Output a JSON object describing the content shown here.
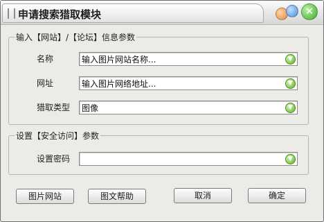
{
  "window": {
    "title": "申请搜索猎取模块"
  },
  "group1": {
    "legend": "输入【网站】/【论坛】信息参数",
    "fields": [
      {
        "label": "名称",
        "value": "输入图片网站名称..."
      },
      {
        "label": "网址",
        "value": "输入图片网络地址..."
      },
      {
        "label": "猎取类型",
        "value": "图像"
      }
    ]
  },
  "group2": {
    "legend": "设置【安全访问】参数",
    "fields": [
      {
        "label": "设置密码",
        "value": ""
      }
    ]
  },
  "buttons": {
    "pic_site": "图片网站",
    "help": "图文帮助",
    "cancel": "取消",
    "ok": "确定"
  },
  "icons": {
    "dropdown": "chevron-down-icon",
    "close": "close-icon",
    "minimize": "minimize-icon",
    "maximize": "maximize-icon"
  }
}
